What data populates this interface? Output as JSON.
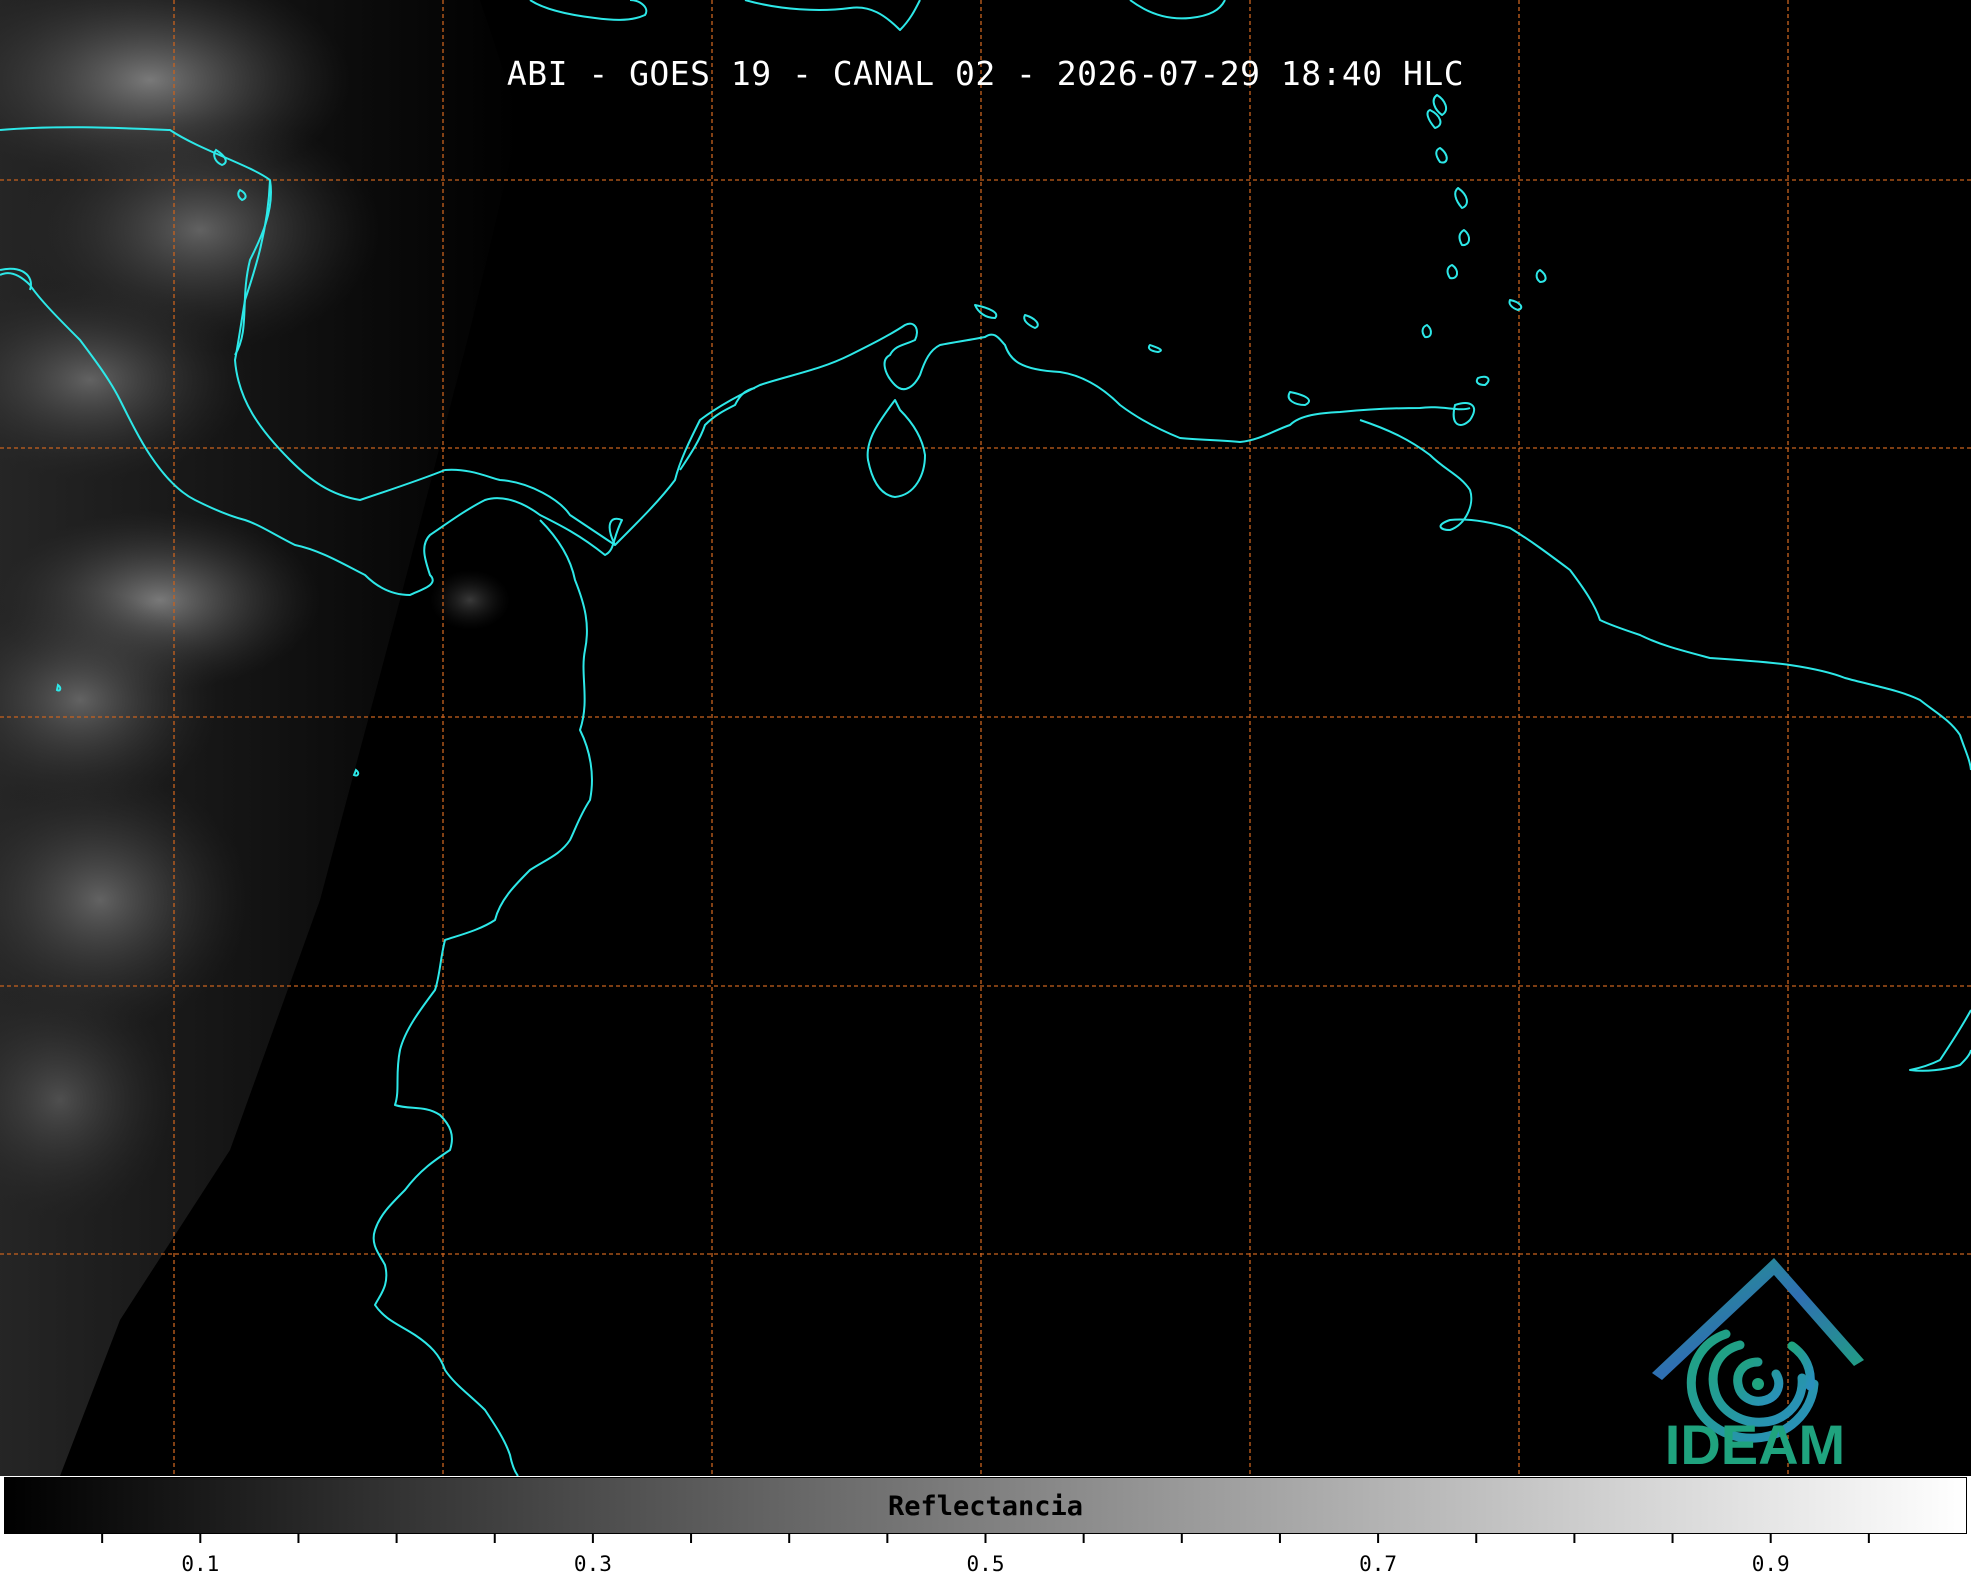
{
  "map": {
    "title": "ABI - GOES 19 - CANAL 02 - 2026-07-29 18:40 HLC",
    "coastline_color": "#2de8e8",
    "graticule_color": "#c8621e",
    "background_color": "#000000"
  },
  "logo": {
    "text": "IDEAM",
    "icon": "ideam-swirl-logo-icon",
    "text_color": "#1fa37e",
    "roof_color": "#2f6fb3"
  },
  "colorbar": {
    "label": "Reflectancia",
    "range": [
      0.0,
      1.0
    ],
    "colormap": "gray",
    "tick_labels": [
      "0.1",
      "0.3",
      "0.5",
      "0.7",
      "0.9"
    ],
    "major_ticks": [
      0.1,
      0.3,
      0.5,
      0.7,
      0.9
    ],
    "minor_ticks": [
      0.05,
      0.15,
      0.2,
      0.25,
      0.35,
      0.4,
      0.45,
      0.55,
      0.6,
      0.65,
      0.75,
      0.8,
      0.85,
      0.95
    ]
  }
}
